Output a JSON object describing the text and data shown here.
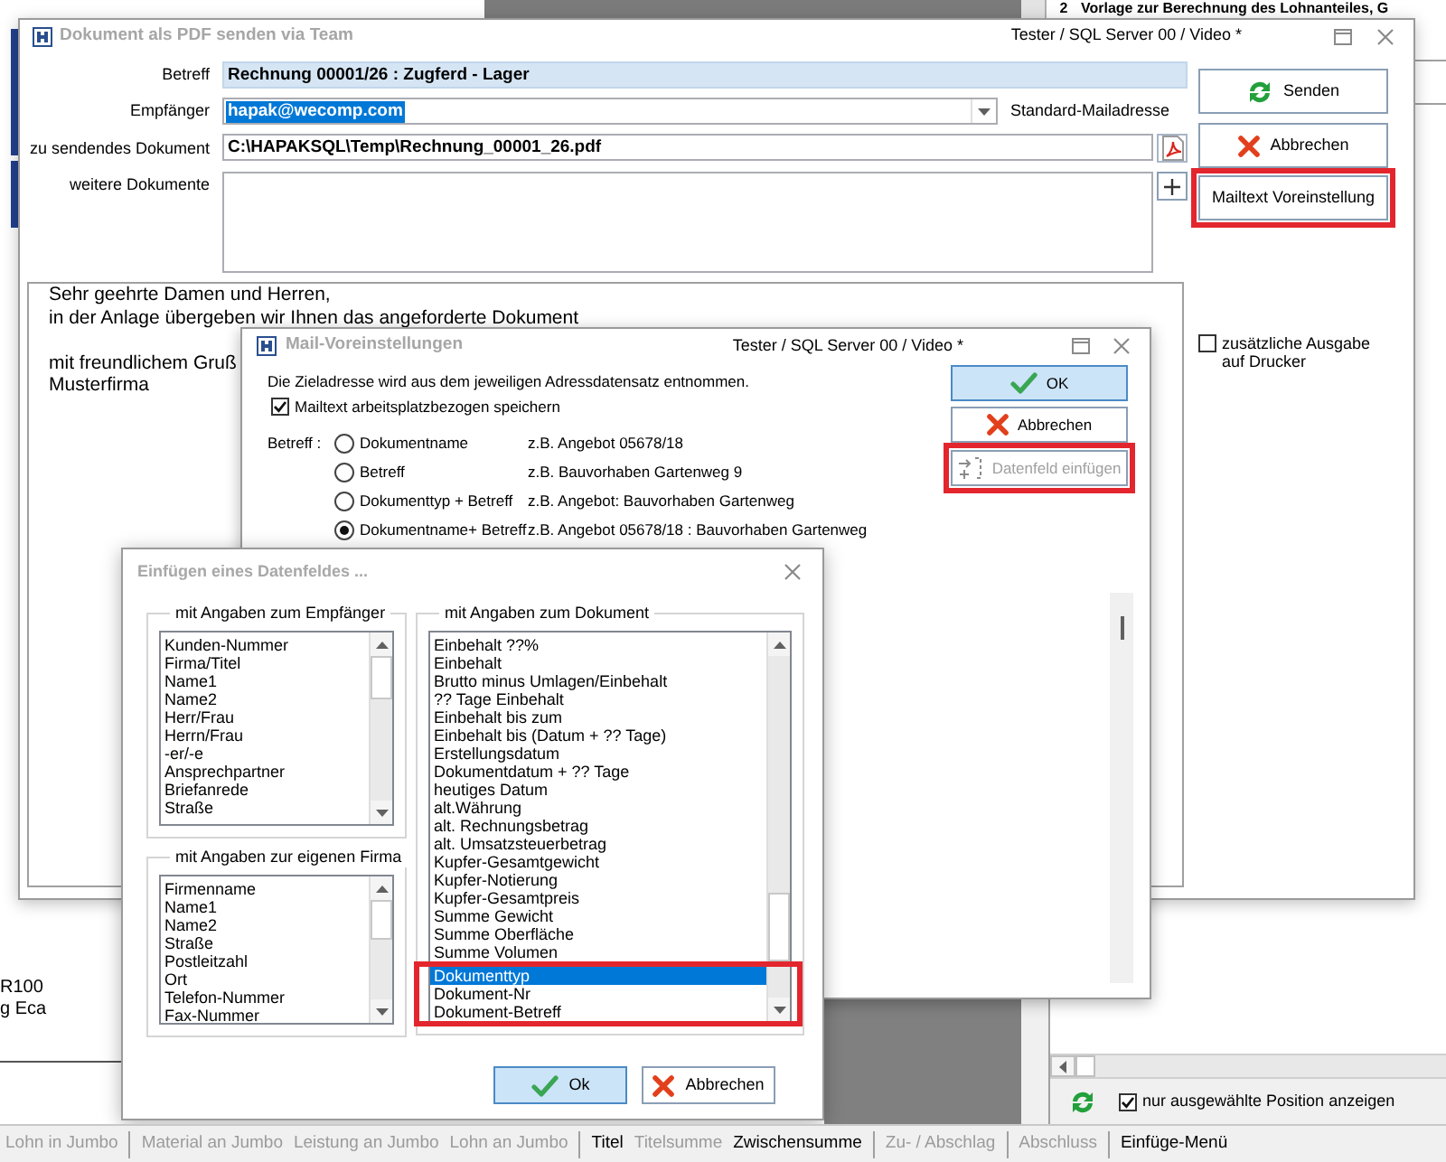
{
  "background_window": {
    "row": {
      "number": "2",
      "text": "Vorlage zur Berechnung des Lohnanteiles, G"
    },
    "left_edge_texts": [
      "R100",
      "g Eca"
    ],
    "show_selected_only": {
      "label": "nur ausgewählte Position anzeigen",
      "checked": true
    }
  },
  "send_window": {
    "title": "Dokument als PDF senden via Team",
    "context": "Tester / SQL Server 00 / Video *",
    "fields": [
      {
        "kind": "text",
        "label": "Betreff",
        "value": "Rechnung 00001/26 : Zugferd - Lager"
      },
      {
        "kind": "combo",
        "label": "Empfänger",
        "value": "hapak@wecomp.com",
        "text_selected": true,
        "note": "Standard-Mailadresse"
      },
      {
        "kind": "file",
        "label": "zu sendendes Dokument",
        "value": "C:\\HAPAKSQL\\Temp\\Rechnung_00001_26.pdf"
      },
      {
        "kind": "list",
        "label": "weitere Dokumente"
      }
    ],
    "buttons": [
      {
        "kind": "send",
        "label": "Senden",
        "highlighted": false
      },
      {
        "kind": "cancel",
        "label": "Abbrechen",
        "highlighted": false
      },
      {
        "kind": "plain",
        "label": "Mailtext Voreinstellung",
        "highlighted": true
      }
    ],
    "mail_text": [
      "Sehr geehrte Damen und Herren,\nin der Anlage übergeben wir Ihnen das angeforderte Dokument",
      "mit freundlichem Gruß\nMusterfirma"
    ],
    "print_option": {
      "label": "zusätzliche Ausgabe auf Drucker",
      "checked": false
    }
  },
  "mail_settings_dialog": {
    "title": "Mail-Voreinstellungen",
    "context": "Tester / SQL Server 00 / Video *",
    "info": "Die Zieladresse wird aus dem jeweiligen Adressdatensatz entnommen.",
    "save_per_workstation": {
      "label": "Mailtext arbeitsplatzbezogen speichern",
      "checked": true
    },
    "subject_label": "Betreff :",
    "subject_options": [
      {
        "label": "Dokumentname",
        "example": "z.B. Angebot 05678/18",
        "selected": false
      },
      {
        "label": "Betreff",
        "example": "z.B. Bauvorhaben Gartenweg 9",
        "selected": false
      },
      {
        "label": "Dokumenttyp + Betreff",
        "example": "z.B. Angebot: Bauvorhaben Gartenweg",
        "selected": false
      },
      {
        "label": "Dokumentname+ Betreff",
        "example": "z.B. Angebot 05678/18 : Bauvorhaben Gartenweg",
        "selected": true
      }
    ],
    "buttons": [
      {
        "kind": "confirm",
        "label": "OK",
        "default": true,
        "disabled": false,
        "highlighted": false
      },
      {
        "kind": "cancel",
        "label": "Abbrechen",
        "default": false,
        "disabled": false,
        "highlighted": false
      },
      {
        "kind": "insert",
        "label": "Datenfeld einfügen",
        "default": false,
        "disabled": true,
        "highlighted": true
      }
    ]
  },
  "insert_field_dialog": {
    "title": "Einfügen eines Datenfeldes ...",
    "groups": [
      {
        "title": "mit Angaben zum Empfänger",
        "items": [
          {
            "label": "Kunden-Nummer",
            "selected": false,
            "highlighted": false
          },
          {
            "label": "Firma/Titel",
            "selected": false,
            "highlighted": false
          },
          {
            "label": "Name1",
            "selected": false,
            "highlighted": false
          },
          {
            "label": "Name2",
            "selected": false,
            "highlighted": false
          },
          {
            "label": "Herr/Frau",
            "selected": false,
            "highlighted": false
          },
          {
            "label": "Herrn/Frau",
            "selected": false,
            "highlighted": false
          },
          {
            "label": "-er/-e",
            "selected": false,
            "highlighted": false
          },
          {
            "label": "Ansprechpartner",
            "selected": false,
            "highlighted": false
          },
          {
            "label": "Briefanrede",
            "selected": false,
            "highlighted": false
          },
          {
            "label": "Straße",
            "selected": false,
            "highlighted": false
          }
        ]
      },
      {
        "title": "mit Angaben zur eigenen Firma",
        "items": [
          {
            "label": "Firmenname",
            "selected": false,
            "highlighted": false
          },
          {
            "label": "Name1",
            "selected": false,
            "highlighted": false
          },
          {
            "label": "Name2",
            "selected": false,
            "highlighted": false
          },
          {
            "label": "Straße",
            "selected": false,
            "highlighted": false
          },
          {
            "label": "Postleitzahl",
            "selected": false,
            "highlighted": false
          },
          {
            "label": "Ort",
            "selected": false,
            "highlighted": false
          },
          {
            "label": "Telefon-Nummer",
            "selected": false,
            "highlighted": false
          },
          {
            "label": "Fax-Nummer",
            "selected": false,
            "highlighted": false
          }
        ]
      },
      {
        "title": "mit Angaben zum Dokument",
        "items": [
          {
            "label": "Einbehalt ??%",
            "selected": false,
            "highlighted": false
          },
          {
            "label": "Einbehalt",
            "selected": false,
            "highlighted": false
          },
          {
            "label": "Brutto minus Umlagen/Einbehalt",
            "selected": false,
            "highlighted": false
          },
          {
            "label": "?? Tage Einbehalt",
            "selected": false,
            "highlighted": false
          },
          {
            "label": "Einbehalt bis zum",
            "selected": false,
            "highlighted": false
          },
          {
            "label": "Einbehalt bis (Datum + ?? Tage)",
            "selected": false,
            "highlighted": false
          },
          {
            "label": "Erstellungsdatum",
            "selected": false,
            "highlighted": false
          },
          {
            "label": "Dokumentdatum + ?? Tage",
            "selected": false,
            "highlighted": false
          },
          {
            "label": "heutiges Datum",
            "selected": false,
            "highlighted": false
          },
          {
            "label": "alt.Währung",
            "selected": false,
            "highlighted": false
          },
          {
            "label": "alt. Rechnungsbetrag",
            "selected": false,
            "highlighted": false
          },
          {
            "label": "alt. Umsatzsteuerbetrag",
            "selected": false,
            "highlighted": false
          },
          {
            "label": "Kupfer-Gesamtgewicht",
            "selected": false,
            "highlighted": false
          },
          {
            "label": "Kupfer-Notierung",
            "selected": false,
            "highlighted": false
          },
          {
            "label": "Kupfer-Gesamtpreis",
            "selected": false,
            "highlighted": false
          },
          {
            "label": "Summe Gewicht",
            "selected": false,
            "highlighted": false
          },
          {
            "label": "Summe Oberfläche",
            "selected": false,
            "highlighted": false
          },
          {
            "label": "Summe Volumen",
            "selected": false,
            "highlighted": false
          },
          {
            "label": "Dokumenttyp",
            "selected": true,
            "highlighted": true
          },
          {
            "label": "Dokument-Nr",
            "selected": false,
            "highlighted": true
          },
          {
            "label": "Dokument-Betreff",
            "selected": false,
            "highlighted": true
          }
        ]
      }
    ],
    "buttons": [
      {
        "kind": "confirm",
        "label": "Ok",
        "default": true
      },
      {
        "kind": "cancel",
        "label": "Abbrechen",
        "default": false
      }
    ]
  },
  "toolbar": [
    [
      {
        "label": "Lohn in Jumbo",
        "disabled": true
      }
    ],
    [
      {
        "label": "Material an Jumbo",
        "disabled": true
      },
      {
        "label": "Leistung an Jumbo",
        "disabled": true
      },
      {
        "label": "Lohn an Jumbo",
        "disabled": true
      }
    ],
    [
      {
        "label": "Titel",
        "disabled": false
      },
      {
        "label": "Titelsumme",
        "disabled": true
      },
      {
        "label": "Zwischensumme",
        "disabled": false
      }
    ],
    [
      {
        "label": "Zu- / Abschlag",
        "disabled": true
      }
    ],
    [
      {
        "label": "Abschluss",
        "disabled": true
      }
    ],
    [
      {
        "label": "Einfüge-Menü",
        "disabled": false
      }
    ]
  ]
}
